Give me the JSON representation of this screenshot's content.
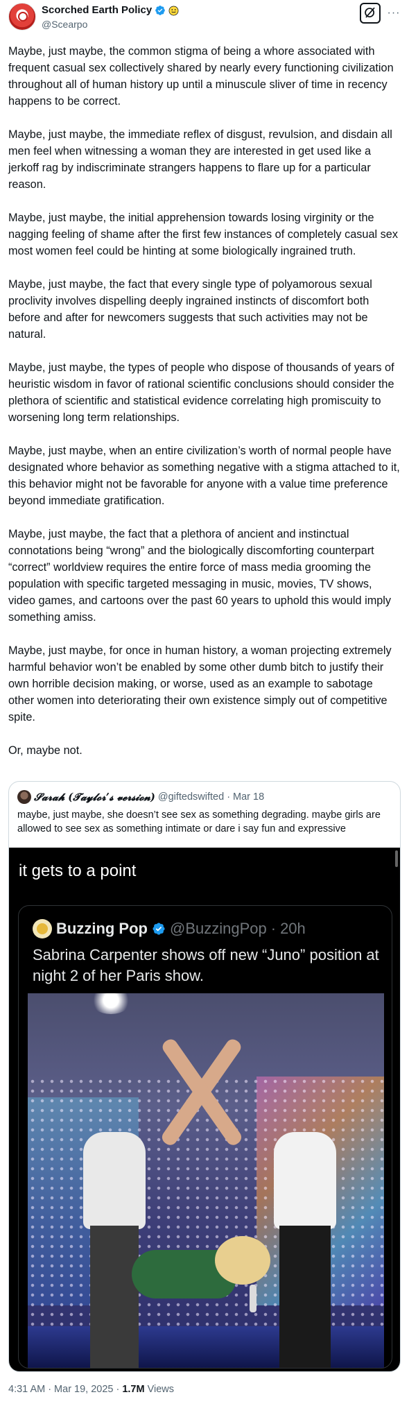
{
  "author": {
    "display_name": "Scorched Earth Policy",
    "handle": "@Scearpo",
    "verified_badge_icon": "verified-badge-icon",
    "emoji_icon": "smiley-emoji-icon"
  },
  "actions": {
    "grok_icon": "grok-icon",
    "more_label": "···"
  },
  "paragraphs": [
    "Maybe, just maybe, the common stigma of being a whore associated with frequent casual sex collectively shared by nearly every functioning civilization throughout all of human history up until a minuscule sliver of time in recency  happens to be correct.",
    "Maybe, just maybe, the immediate reflex of disgust, revulsion, and disdain all men feel when witnessing a woman they are interested in get used like a jerkoff rag by indiscriminate strangers happens to flare up for a particular reason.",
    "Maybe, just maybe, the initial apprehension towards losing virginity or the nagging feeling of shame after the first few instances of completely casual sex most women feel could be hinting at some biologically ingrained truth.",
    "Maybe, just maybe, the fact that every single type of polyamorous sexual proclivity involves dispelling deeply ingrained instincts of discomfort both before and after for newcomers suggests that such activities may not be natural.",
    "Maybe, just maybe, the types of people who dispose of thousands of years of heuristic wisdom in favor of rational scientific conclusions should consider the plethora of scientific and statistical evidence correlating high promiscuity to worsening long term relationships.",
    "Maybe, just maybe, when an entire civilization’s worth of normal people have designated whore behavior as something negative with a stigma attached to it, this behavior might not be favorable for anyone with a value time preference beyond immediate gratification.",
    "Maybe, just maybe, the fact that a plethora of ancient and instinctual connotations being “wrong” and the biologically discomforting counterpart “correct” worldview requires the entire force of mass media grooming the population with specific targeted messaging in music, movies, TV shows, video games, and cartoons over the past 60 years to uphold this would imply something amiss.",
    "Maybe, just maybe, for once in human history, a woman projecting extremely harmful behavior won’t be enabled by some other dumb bitch to justify their own horrible decision making, or worse, used as an example to sabotage other women into deteriorating their own existence simply out of competitive spite.",
    "Or, maybe not."
  ],
  "quote": {
    "display_name": "𝓢𝓪𝓻𝓪𝓱 (𝓣𝓪𝔂𝓵𝓸𝓻’𝓼 𝓿𝓮𝓻𝓼𝓲𝓸𝓷)",
    "handle": "@giftedswifted",
    "separator": "·",
    "date": "Mar 18",
    "text": "maybe, just maybe, she doesn’t see sex as something degrading. maybe girls are allowed to see sex as something intimate or dare i say fun and expressive",
    "media_caption": "it gets to a point",
    "embedded": {
      "display_name": "Buzzing Pop",
      "handle": "@BuzzingPop",
      "separator": "·",
      "time": "20h",
      "text": "Sabrina Carpenter shows off new “Juno” position at night 2 of her Paris show."
    }
  },
  "footer": {
    "time": "4:31 AM",
    "separator": "·",
    "date": "Mar 19, 2025",
    "separator2": "·",
    "views_count": "1.7M",
    "views_label": "Views"
  },
  "colors": {
    "text_primary": "#0f1419",
    "text_secondary": "#536471",
    "verified_blue": "#1d9bf0",
    "border": "#cfd9de"
  }
}
